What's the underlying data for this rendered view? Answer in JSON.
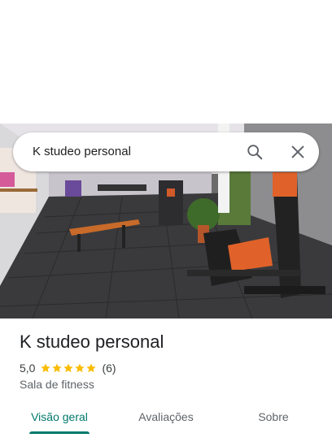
{
  "search": {
    "query": "K studeo personal"
  },
  "place": {
    "name": "K studeo personal",
    "rating": "5,0",
    "star_count": 5,
    "review_count": "(6)",
    "category": "Sala de fitness"
  },
  "tabs": [
    {
      "label": "Visão geral",
      "active": true
    },
    {
      "label": "Avaliações",
      "active": false
    },
    {
      "label": "Sobre",
      "active": false
    }
  ],
  "colors": {
    "accent": "#00796b",
    "star": "#fbbc04"
  },
  "icons": [
    "search-icon",
    "close-icon",
    "star-icon"
  ]
}
